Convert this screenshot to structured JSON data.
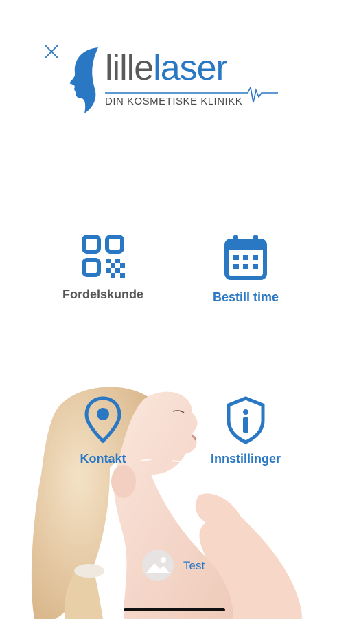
{
  "brand": {
    "name_part1": "lille",
    "name_part2": "laser",
    "tagline": "DIN KOSMETISKE KLINIKK"
  },
  "menu": {
    "fordelskunde": "Fordelskunde",
    "bestill_time": "Bestill time",
    "kontakt": "Kontakt",
    "innstillinger": "Innstillinger",
    "test": "Test"
  },
  "colors": {
    "accent": "#2a78c4",
    "label_gray": "#555555"
  },
  "icons": {
    "close": "close-icon",
    "fordelskunde": "qr-code-icon",
    "bestill_time": "calendar-icon",
    "kontakt": "location-pin-icon",
    "innstillinger": "info-shield-icon",
    "test": "image-placeholder-icon"
  }
}
